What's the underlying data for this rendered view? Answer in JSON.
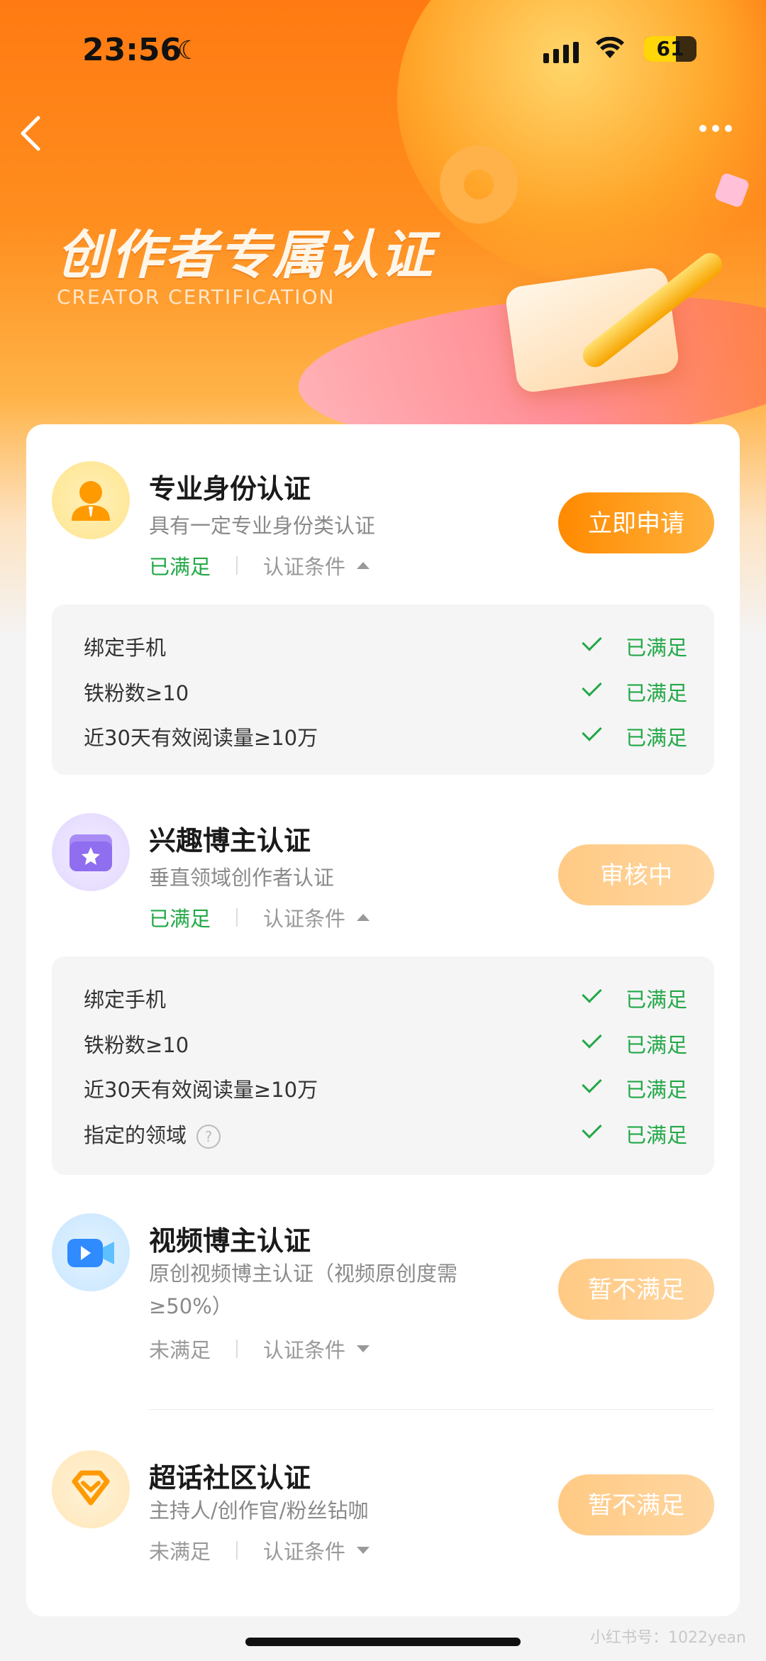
{
  "status_bar": {
    "time": "23:56",
    "battery": "61",
    "battery_level": 0.61
  },
  "header": {
    "title": "创作者专属认证",
    "subtitle": "CREATOR CERTIFICATION"
  },
  "sections": [
    {
      "title": "专业身份认证",
      "desc": "具有一定专业身份类认证",
      "status": "已满足",
      "cond_label": "认证条件",
      "button": "立即申请",
      "conditions": [
        {
          "name": "绑定手机",
          "state": "已满足"
        },
        {
          "name": "铁粉数≥10",
          "state": "已满足"
        },
        {
          "name": "近30天有效阅读量≥10万",
          "state": "已满足"
        }
      ]
    },
    {
      "title": "兴趣博主认证",
      "desc": "垂直领域创作者认证",
      "status": "已满足",
      "cond_label": "认证条件",
      "button": "审核中",
      "conditions": [
        {
          "name": "绑定手机",
          "state": "已满足"
        },
        {
          "name": "铁粉数≥10",
          "state": "已满足"
        },
        {
          "name": "近30天有效阅读量≥10万",
          "state": "已满足"
        },
        {
          "name": "指定的领域",
          "state": "已满足"
        }
      ]
    },
    {
      "title": "视频博主认证",
      "desc": "原创视频博主认证（视频原创度需≥50%）",
      "status": "未满足",
      "cond_label": "认证条件",
      "button": "暂不满足"
    },
    {
      "title": "超话社区认证",
      "desc": "主持人/创作官/粉丝钻咖",
      "status": "未满足",
      "cond_label": "认证条件",
      "button": "暂不满足"
    }
  ],
  "watermark": "小红书号：1022yean"
}
